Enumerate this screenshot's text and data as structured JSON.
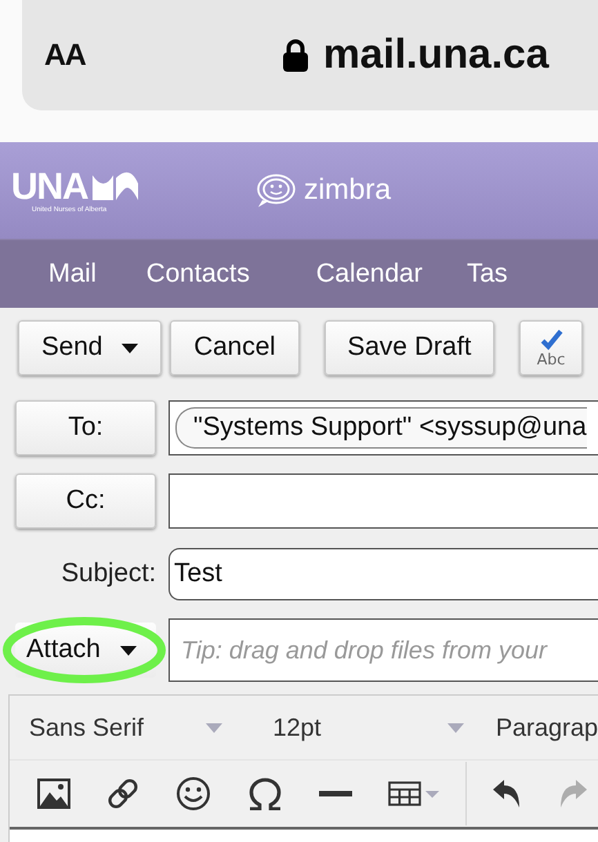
{
  "browser": {
    "text_size_button": "AA",
    "url": "mail.una.ca"
  },
  "header": {
    "logo_text": "UNA",
    "logo_tagline": "United Nurses of Alberta",
    "brand": "zimbra"
  },
  "nav": [
    {
      "label": "Mail"
    },
    {
      "label": "Contacts"
    },
    {
      "label": "Calendar"
    },
    {
      "label": "Tas"
    }
  ],
  "toolbar": [
    {
      "kind": "menu",
      "label": "Send"
    },
    {
      "kind": "plain",
      "label": "Cancel"
    },
    {
      "kind": "plain",
      "label": "Save Draft"
    },
    {
      "kind": "spellcheck",
      "label": "Abc"
    }
  ],
  "fields": [
    {
      "kind": "button",
      "label": "To:",
      "chips": [
        "\"Systems Support\" <syssup@una"
      ]
    },
    {
      "kind": "button",
      "label": "Cc:"
    },
    {
      "kind": "text",
      "label": "Subject:",
      "value": "Test"
    }
  ],
  "attach": {
    "label": "Attach",
    "highlighted": true,
    "placeholder": "Tip: drag and drop files from your"
  },
  "editor": {
    "font": "Sans Serif",
    "size": "12pt",
    "format": "Paragrap",
    "tools": [
      {
        "kind": "image",
        "disabled": false
      },
      {
        "kind": "link",
        "disabled": false
      },
      {
        "kind": "emoji",
        "disabled": false
      },
      {
        "kind": "special-char",
        "disabled": false
      },
      {
        "kind": "rule",
        "disabled": false
      },
      {
        "kind": "table",
        "disabled": false
      },
      {
        "kind": "separator"
      },
      {
        "kind": "undo",
        "disabled": false
      },
      {
        "kind": "redo",
        "disabled": true
      }
    ]
  }
}
